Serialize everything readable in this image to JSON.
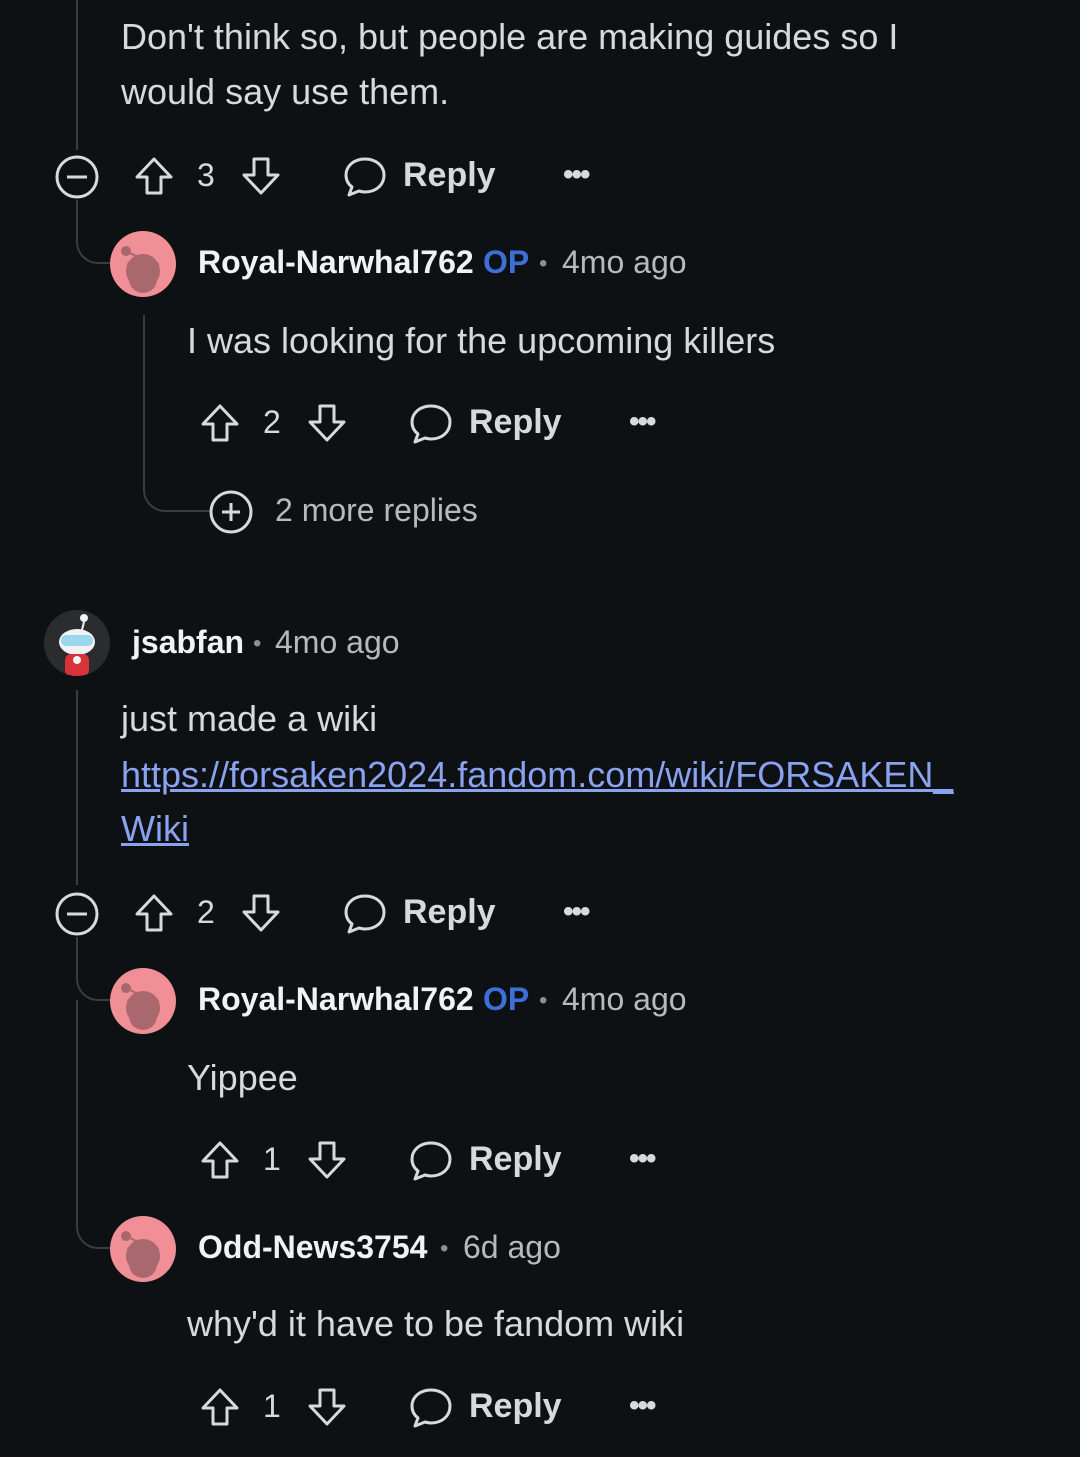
{
  "colors": {
    "background": "#0e1113",
    "op_badge": "#3e6fd8",
    "link": "#8aa2f0",
    "avatar_pink": "#f08f96"
  },
  "comments": {
    "c1": {
      "body_line1": "Don't think so, but people are making guides so I",
      "body_line2": "would say use them.",
      "score": "3",
      "reply_label": "Reply",
      "collapse_icon": "collapse-minus-icon"
    },
    "c2": {
      "username": "Royal-Narwhal762",
      "op_badge": "OP",
      "separator": "•",
      "time": "4mo ago",
      "body": "I was looking for the upcoming killers",
      "score": "2",
      "reply_label": "Reply",
      "more_replies": "2 more replies"
    },
    "c3": {
      "username": "jsabfan",
      "separator": "•",
      "time": "4mo ago",
      "body": "just made a wiki",
      "link_line1": "https://forsaken2024.fandom.com/wiki/FORSAKEN_",
      "link_line2": "Wiki",
      "score": "2",
      "reply_label": "Reply"
    },
    "c4": {
      "username": "Royal-Narwhal762",
      "op_badge": "OP",
      "separator": "•",
      "time": "4mo ago",
      "body": "Yippee",
      "score": "1",
      "reply_label": "Reply"
    },
    "c5": {
      "username": "Odd-News3754",
      "separator": "•",
      "time": "6d ago",
      "body": "why'd it have to be fandom wiki",
      "score": "1",
      "reply_label": "Reply"
    }
  },
  "icons": {
    "upvote": "upvote-arrow-icon",
    "downvote": "downvote-arrow-icon",
    "reply": "speech-bubble-icon",
    "more": "more-options-icon",
    "expand": "expand-plus-icon",
    "avatar": "snoo-avatar-icon"
  }
}
